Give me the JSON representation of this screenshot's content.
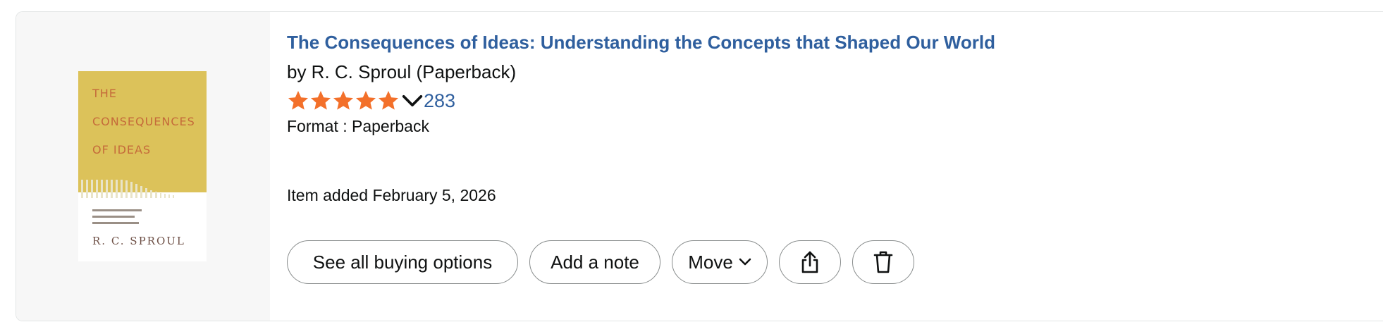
{
  "item": {
    "title": "The Consequences of Ideas: Understanding the Concepts that Shaped Our World",
    "byline": "by R. C. Sproul (Paperback)",
    "rating": {
      "stars": 5,
      "count": "283"
    },
    "format": "Format : Paperback",
    "added": "Item added February 5, 2026"
  },
  "cover": {
    "title_lines": [
      "THE",
      "CONSEQUENCES",
      "OF IDEAS"
    ],
    "author": "R. C. SPROUL",
    "colors": {
      "background": "#dcc25a",
      "title": "#c56a3a",
      "author": "#6e5046"
    }
  },
  "actions": {
    "buy_label": "See all buying options",
    "note_label": "Add a note",
    "move_label": "Move",
    "share_icon": "share-icon",
    "delete_icon": "trash-icon"
  },
  "colors": {
    "link": "#2f5f9e",
    "star": "#f3702a",
    "text": "#0f1111",
    "button_border": "#888c8c"
  }
}
